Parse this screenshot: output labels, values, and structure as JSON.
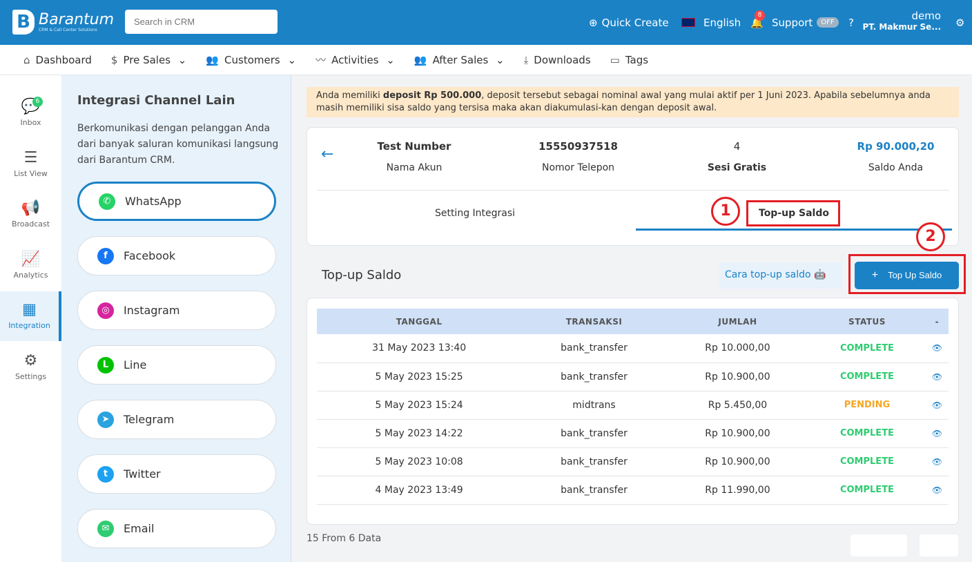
{
  "header": {
    "logo_name": "Barantum",
    "logo_sub": "CRM & Call Center Solutions",
    "search_placeholder": "Search in CRM",
    "quick_create": "Quick Create",
    "language": "English",
    "notif_count": "8",
    "support": "Support",
    "support_state": "OFF",
    "user": "demo",
    "company": "PT. Makmur Se..."
  },
  "nav": [
    {
      "icon": "⌂",
      "label": "Dashboard"
    },
    {
      "icon": "$",
      "label": "Pre Sales",
      "dd": true
    },
    {
      "icon": "👥",
      "label": "Customers",
      "dd": true
    },
    {
      "icon": "〰",
      "label": "Activities",
      "dd": true
    },
    {
      "icon": "👥",
      "label": "After Sales",
      "dd": true
    },
    {
      "icon": "⤓",
      "label": "Downloads"
    },
    {
      "icon": "▭",
      "label": "Tags"
    }
  ],
  "sidebar": [
    {
      "icon": "💬",
      "label": "Inbox",
      "badge": "6"
    },
    {
      "icon": "☰",
      "label": "List View"
    },
    {
      "icon": "📢",
      "label": "Broadcast"
    },
    {
      "icon": "📈",
      "label": "Analytics"
    },
    {
      "icon": "▦",
      "label": "Integration",
      "active": true
    },
    {
      "icon": "⚙",
      "label": "Settings"
    }
  ],
  "channels": {
    "title": "Integrasi Channel Lain",
    "desc": "Berkomunikasi dengan pelanggan Anda dari banyak saluran komunikasi langsung dari Barantum CRM.",
    "items": [
      {
        "label": "WhatsApp",
        "color": "#25d366",
        "g": "✆",
        "active": true
      },
      {
        "label": "Facebook",
        "color": "#1877f2",
        "g": "f"
      },
      {
        "label": "Instagram",
        "color": "#d6249f",
        "g": "◎"
      },
      {
        "label": "Line",
        "color": "#00c300",
        "g": "L"
      },
      {
        "label": "Telegram",
        "color": "#2aa3de",
        "g": "➤"
      },
      {
        "label": "Twitter",
        "color": "#1da1f2",
        "g": "t"
      },
      {
        "label": "Email",
        "color": "#2ecc71",
        "g": "✉"
      }
    ]
  },
  "alert": {
    "pre": "Anda memiliki ",
    "bold": "deposit Rp 500.000",
    "post": ", deposit tersebut sebagai nominal awal yang mulai aktif per 1 Juni 2023. Apabila sebelumnya anda masih memiliki sisa saldo yang tersisa maka akan diakumulasi-kan dengan deposit awal."
  },
  "account": {
    "name": "Test Number",
    "name_label": "Nama Akun",
    "phone": "15550937518",
    "phone_label": "Nomor Telepon",
    "sessions": "4",
    "sessions_label": "Sesi Gratis",
    "balance": "Rp 90.000,20",
    "balance_label": "Saldo Anda"
  },
  "tabs": [
    "Setting Integrasi",
    "Top-up Saldo"
  ],
  "annotations": [
    "1",
    "2"
  ],
  "topup": {
    "title": "Top-up Saldo",
    "howto": "Cara top-up saldo",
    "button": "Top Up Saldo"
  },
  "table": {
    "headers": [
      "TANGGAL",
      "TRANSAKSI",
      "JUMLAH",
      "STATUS",
      "-"
    ],
    "rows": [
      [
        "31 May 2023 13:40",
        "bank_transfer",
        "Rp 10.000,00",
        "COMPLETE"
      ],
      [
        "5 May 2023 15:25",
        "bank_transfer",
        "Rp 10.900,00",
        "COMPLETE"
      ],
      [
        "5 May 2023 15:24",
        "midtrans",
        "Rp 5.450,00",
        "PENDING"
      ],
      [
        "5 May 2023 14:22",
        "bank_transfer",
        "Rp 10.900,00",
        "COMPLETE"
      ],
      [
        "5 May 2023 10:08",
        "bank_transfer",
        "Rp 10.900,00",
        "COMPLETE"
      ],
      [
        "4 May 2023 13:49",
        "bank_transfer",
        "Rp 11.990,00",
        "COMPLETE"
      ]
    ]
  },
  "status_colors": {
    "COMPLETE": "#2ecc71",
    "PENDING": "#f5a623"
  },
  "footer": "15 From 6 Data"
}
